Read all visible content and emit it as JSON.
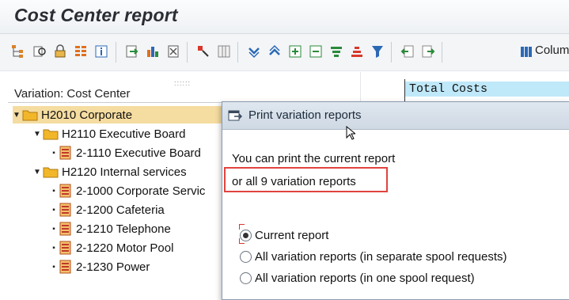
{
  "window": {
    "title": "Cost Center report"
  },
  "toolbar": {
    "icons": [
      "hierarchy-icon",
      "find-icon",
      "lock-icon",
      "layout-icon",
      "info-icon",
      "export-icon",
      "chart-icon",
      "delete-icon",
      "select-icon",
      "grid-icon",
      "expand-all-icon",
      "collapse-all-icon",
      "expand-node-icon",
      "collapse-node-icon",
      "sort-asc-icon",
      "sort-desc-icon",
      "filter-icon",
      "previous-icon",
      "next-icon",
      "columns-icon"
    ],
    "columns_label": "Column"
  },
  "tree": {
    "header": "Variation: Cost Center",
    "nodes": [
      {
        "label": "H2010 Corporate",
        "type": "folder",
        "level": 0,
        "selected": true
      },
      {
        "label": "H2110 Executive Board",
        "type": "folder",
        "level": 1
      },
      {
        "label": "2-1110 Executive Board",
        "type": "costcenter",
        "level": 2
      },
      {
        "label": "H2120 Internal services",
        "type": "folder",
        "level": 1
      },
      {
        "label": "2-1000 Corporate Servic",
        "type": "costcenter",
        "level": 2
      },
      {
        "label": "2-1200 Cafeteria",
        "type": "costcenter",
        "level": 2
      },
      {
        "label": "2-1210 Telephone",
        "type": "costcenter",
        "level": 2
      },
      {
        "label": "2-1220 Motor Pool",
        "type": "costcenter",
        "level": 2
      },
      {
        "label": "2-1230 Power",
        "type": "costcenter",
        "level": 2
      }
    ]
  },
  "report": {
    "total_costs_label": "Total Costs"
  },
  "dialog": {
    "title": "Print variation reports",
    "line1": "You can print the current report",
    "line2": "or all 9 variation reports",
    "options": [
      {
        "label": "Current report",
        "checked": true
      },
      {
        "label": "All variation reports (in separate spool requests)",
        "checked": false
      },
      {
        "label": "All variation reports (in one spool request)",
        "checked": false
      }
    ]
  },
  "colors": {
    "selection": "#f5dca0",
    "header_cyan": "#bfe8f8",
    "highlight_box": "#e0443e",
    "folder": "#f2b62a"
  }
}
